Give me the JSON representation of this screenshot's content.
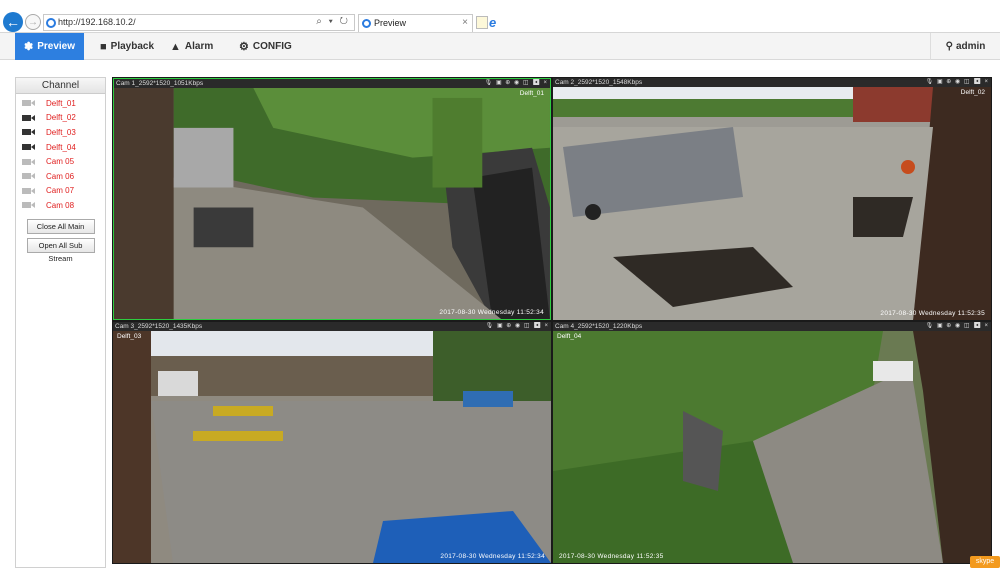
{
  "browser": {
    "url": "http://192.168.10.2/",
    "tab_title": "Preview",
    "address_tools": "⌕ ▾ ↻",
    "tab_close": "×"
  },
  "nav": {
    "preview": "Preview",
    "playback": "Playback",
    "alarm": "Alarm",
    "config": "CONFIG",
    "user": "admin",
    "active": "preview",
    "accent": "#2d7fe0"
  },
  "sidebar": {
    "title": "Channel",
    "channels": [
      {
        "label": "Delft_01",
        "icon": "camera-icon"
      },
      {
        "label": "Delft_02",
        "icon": "camera-icon"
      },
      {
        "label": "Delft_03",
        "icon": "camera-icon"
      },
      {
        "label": "Delft_04",
        "icon": "camera-icon"
      },
      {
        "label": "Cam 05",
        "icon": "camera-icon"
      },
      {
        "label": "Cam 06",
        "icon": "camera-icon"
      },
      {
        "label": "Cam 07",
        "icon": "camera-icon"
      },
      {
        "label": "Cam 08",
        "icon": "camera-icon"
      }
    ],
    "close_all_main": "Close All Main",
    "open_all_sub": "Open All Sub Stream"
  },
  "cameras": [
    {
      "header": "Cam 1_2592*1520_1051Kbps",
      "osd_name": "Delft_01",
      "osd_time": "2017-08-30 Wednesday 11:52:34",
      "selected": true
    },
    {
      "header": "Cam 2_2592*1520_1548Kbps",
      "osd_name": "Delft_02",
      "osd_time": "2017-08-30 Wednesday 11:52:35",
      "selected": false
    },
    {
      "header": "Cam 3_2592*1520_1435Kbps",
      "osd_name": "Delft_03",
      "osd_time": "2017-08-30 Wednesday 11:52:34",
      "selected": false
    },
    {
      "header": "Cam 4_2592*1520_1220Kbps",
      "osd_name": "Delft_04",
      "osd_time": "2017-08-30 Wednesday 11:52:35",
      "selected": false
    }
  ],
  "cell_tools": "🎙 ▣ ⊕ ◉ ◫ ◀ ×",
  "skype": "skype"
}
